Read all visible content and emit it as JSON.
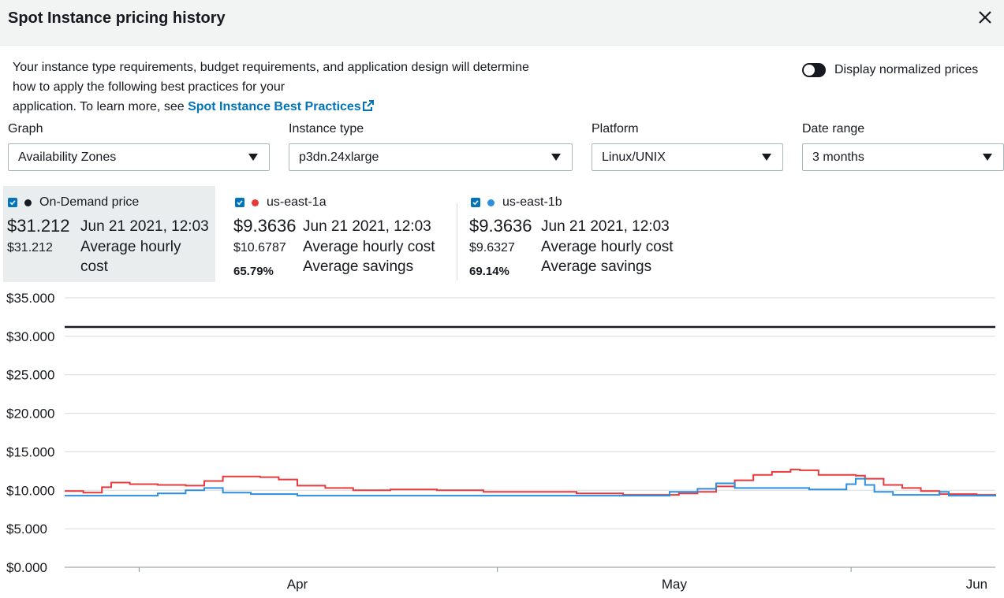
{
  "header": {
    "title": "Spot Instance pricing history",
    "close_icon": "close-icon"
  },
  "description": {
    "text": "Your instance type requirements, budget requirements, and application design will determine how to apply the following best practices for your application. To learn more, see ",
    "line1": "Your instance type requirements, budget requirements, and application design will determine",
    "line2": "how to apply the following best practices for your",
    "line3": "application. To learn more, see ",
    "link_label": "Spot Instance Best Practices",
    "link_icon": "external-link-icon"
  },
  "toggle": {
    "label": "Display normalized prices",
    "on": false
  },
  "filters": {
    "graph": {
      "label": "Graph",
      "value": "Availability Zones"
    },
    "instance_type": {
      "label": "Instance type",
      "value": "p3dn.24xlarge"
    },
    "platform": {
      "label": "Platform",
      "value": "Linux/UNIX"
    },
    "date_range": {
      "label": "Date range",
      "value": "3 months"
    }
  },
  "legend": [
    {
      "name": "On-Demand price",
      "color": "#16191f",
      "price": "$31.212",
      "date": "Jun 21 2021, 12:03",
      "avg_cost": "$31.212",
      "avg_cost_label": "Average hourly cost",
      "savings": "",
      "savings_label": ""
    },
    {
      "name": "us-east-1a",
      "color": "#e8393d",
      "price": "$9.3636",
      "date": "Jun 21 2021, 12:03",
      "avg_cost": "$10.6787",
      "avg_cost_label": "Average hourly cost",
      "savings": "65.79%",
      "savings_label": "Average savings"
    },
    {
      "name": "us-east-1b",
      "color": "#2d8fe0",
      "price": "$9.3636",
      "date": "Jun 21 2021, 12:03",
      "avg_cost": "$9.6327",
      "avg_cost_label": "Average hourly cost",
      "savings": "69.14%",
      "savings_label": "Average savings"
    }
  ],
  "chart_data": {
    "type": "line",
    "y_ticks": [
      "$35.000",
      "$30.000",
      "$25.000",
      "$20.000",
      "$15.000",
      "$10.000",
      "$5.000",
      "$0.000"
    ],
    "ylim": [
      0,
      35
    ],
    "x_ticks": [
      "Apr",
      "May",
      "Jun"
    ],
    "grid": true,
    "series": [
      {
        "name": "On-Demand price",
        "color": "#16191f",
        "points": [
          [
            0,
            31.212
          ],
          [
            100,
            31.212
          ]
        ]
      },
      {
        "name": "us-east-1a",
        "color": "#e8393d",
        "points": [
          [
            0,
            9.9
          ],
          [
            2,
            9.7
          ],
          [
            4,
            10.4
          ],
          [
            5,
            11.0
          ],
          [
            7,
            10.8
          ],
          [
            10,
            10.7
          ],
          [
            13,
            10.6
          ],
          [
            15,
            11.2
          ],
          [
            17,
            11.8
          ],
          [
            21,
            11.7
          ],
          [
            23,
            11.4
          ],
          [
            25,
            10.6
          ],
          [
            28,
            10.3
          ],
          [
            31,
            10.0
          ],
          [
            35,
            10.1
          ],
          [
            40,
            10.0
          ],
          [
            45,
            9.8
          ],
          [
            50,
            9.8
          ],
          [
            55,
            9.6
          ],
          [
            60,
            9.4
          ],
          [
            66,
            9.6
          ],
          [
            68,
            9.8
          ],
          [
            70,
            10.5
          ],
          [
            72,
            11.3
          ],
          [
            74,
            12.0
          ],
          [
            76,
            12.4
          ],
          [
            78,
            12.7
          ],
          [
            79,
            12.6
          ],
          [
            81,
            12.0
          ],
          [
            85,
            11.9
          ],
          [
            86,
            11.5
          ],
          [
            88,
            10.7
          ],
          [
            90,
            10.3
          ],
          [
            92,
            9.9
          ],
          [
            94,
            9.5
          ],
          [
            98,
            9.4
          ],
          [
            100,
            9.36
          ]
        ]
      },
      {
        "name": "us-east-1b",
        "color": "#2d8fe0",
        "points": [
          [
            0,
            9.3
          ],
          [
            5,
            9.3
          ],
          [
            10,
            9.6
          ],
          [
            13,
            10.0
          ],
          [
            15,
            10.3
          ],
          [
            17,
            9.7
          ],
          [
            20,
            9.5
          ],
          [
            23,
            9.5
          ],
          [
            25,
            9.3
          ],
          [
            30,
            9.3
          ],
          [
            50,
            9.3
          ],
          [
            64,
            9.3
          ],
          [
            65,
            9.8
          ],
          [
            68,
            10.2
          ],
          [
            70,
            10.9
          ],
          [
            72,
            10.3
          ],
          [
            78,
            10.3
          ],
          [
            80,
            10.1
          ],
          [
            83,
            10.1
          ],
          [
            84,
            10.8
          ],
          [
            85,
            11.5
          ],
          [
            86,
            10.7
          ],
          [
            87,
            9.8
          ],
          [
            89,
            9.4
          ],
          [
            93,
            9.4
          ],
          [
            94,
            9.8
          ],
          [
            95,
            9.3
          ],
          [
            100,
            9.36
          ]
        ]
      }
    ]
  }
}
